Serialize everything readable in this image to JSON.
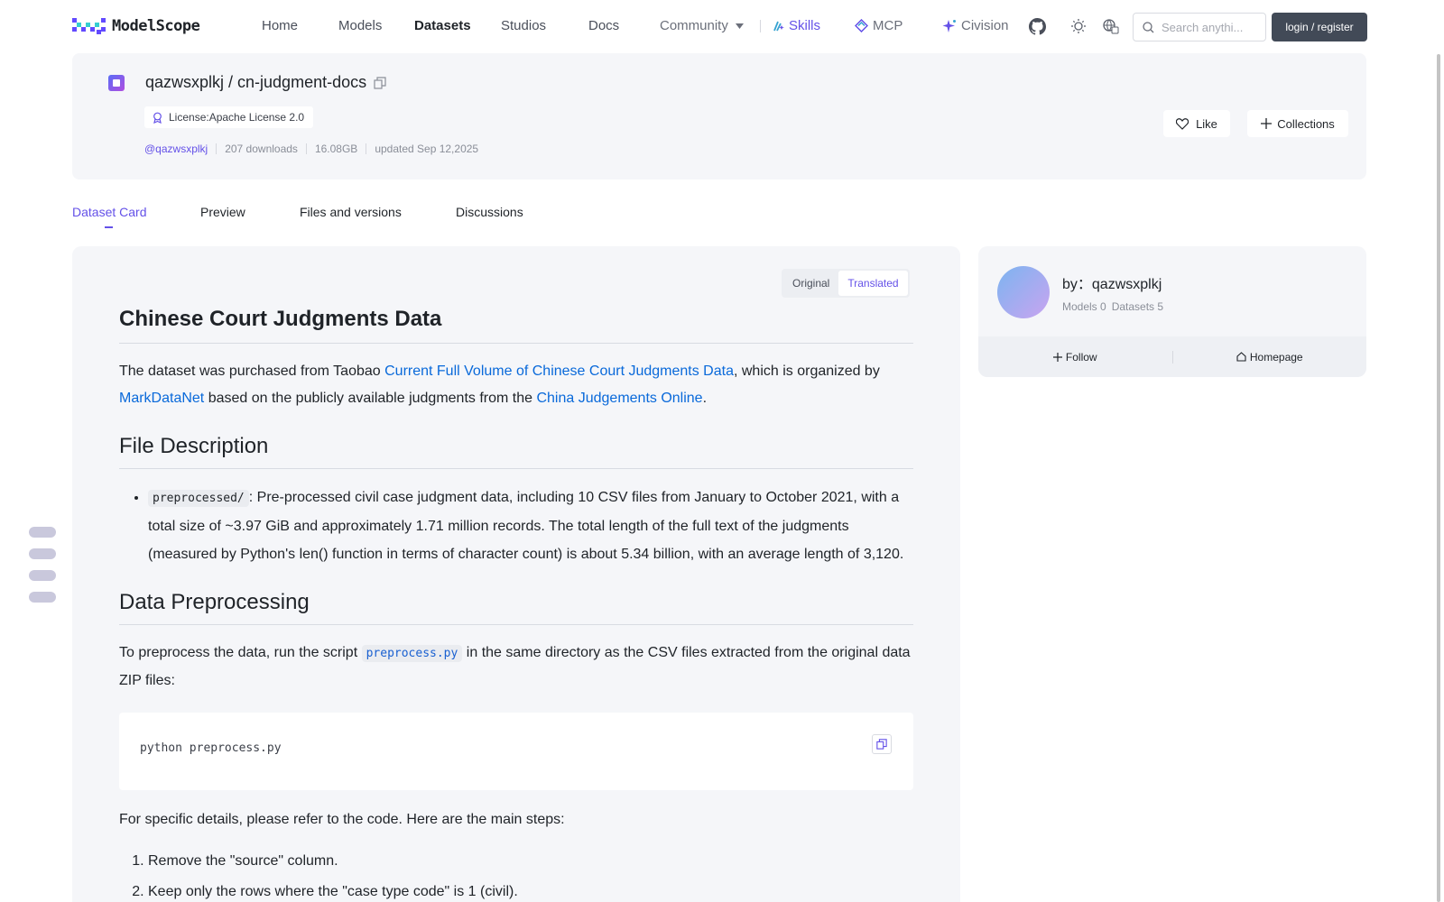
{
  "nav": {
    "logo_text": "ModelScope",
    "items": {
      "home": "Home",
      "models": "Models",
      "datasets": "Datasets",
      "studios": "Studios",
      "docs": "Docs",
      "community": "Community",
      "skills": "Skills",
      "mcp": "MCP",
      "civision": "Civision"
    },
    "search_placeholder": "Search anythi...",
    "login_label": "login / register"
  },
  "dataset": {
    "title": "qazwsxplkj / cn-judgment-docs",
    "license": "License:Apache License 2.0",
    "author": "@qazwsxplkj",
    "downloads": "207 downloads",
    "size": "16.08GB",
    "updated": "updated Sep 12,2025",
    "like_label": "Like",
    "collections_label": "Collections"
  },
  "tabs": {
    "card": "Dataset Card",
    "preview": "Preview",
    "files": "Files and versions",
    "discussions": "Discussions"
  },
  "toggle": {
    "original": "Original",
    "translated": "Translated"
  },
  "content": {
    "title": "Chinese Court Judgments Data",
    "intro_1": "The dataset was purchased from Taobao ",
    "intro_link_1": "Current Full Volume of Chinese Court Judgments Data",
    "intro_2": ", which is organized by ",
    "intro_link_2": "MarkDataNet",
    "intro_3": " based on the publicly available judgments from the ",
    "intro_link_3": "China Judgements Online",
    "intro_4": ".",
    "h_files": "File Description",
    "file_code": "preprocessed/",
    "file_text": ": Pre-processed civil case judgment data, including 10 CSV files from January to October 2021, with a total size of ~3.97 GiB and approximately 1.71 million records. The total length of the full text of the judgments (measured by Python's len() function in terms of character count) is about 5.34 billion, with an average length of 3,120.",
    "h_preprocess": "Data Preprocessing",
    "pre_1": "To preprocess the data, run the script ",
    "pre_code": "preprocess.py",
    "pre_2": " in the same directory as the CSV files extracted from the original data ZIP files:",
    "code_block": "python preprocess.py",
    "steps_intro": "For specific details, please refer to the code. Here are the main steps:",
    "steps": [
      "Remove the \"source\" column.",
      "Keep only the rows where the \"case type code\" is 1 (civil)."
    ]
  },
  "author_card": {
    "by": "by：qazwsxplkj",
    "models": "Models 0",
    "datasets": "Datasets 5",
    "follow": "Follow",
    "homepage": "Homepage"
  },
  "colors": {
    "accent": "#6451e8",
    "link": "#0969da",
    "card_bg": "#f5f6f9"
  }
}
